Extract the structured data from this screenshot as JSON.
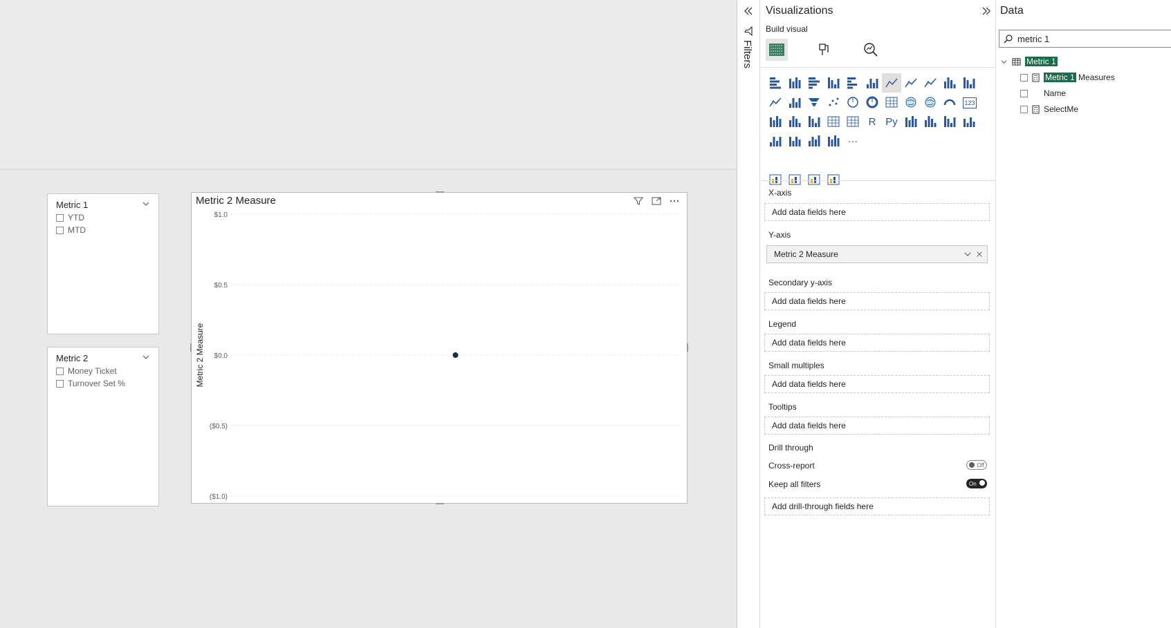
{
  "slicers": [
    {
      "title": "Metric 1",
      "items": [
        "YTD",
        "MTD"
      ]
    },
    {
      "title": "Metric 2",
      "items": [
        "Money Ticket",
        "Turnover Set %"
      ]
    }
  ],
  "chart": {
    "title": "Metric 2 Measure"
  },
  "chart_data": {
    "type": "scatter",
    "title": "Metric 2 Measure",
    "xlabel": "",
    "ylabel": "Metric 2 Measure",
    "ylim": [
      -1.0,
      1.0
    ],
    "yticks": [
      "$1.0",
      "$0.5",
      "$0.0",
      "($0.5)",
      "($1.0)"
    ],
    "ytick_values": [
      1.0,
      0.5,
      0.0,
      -0.5,
      -1.0
    ],
    "points": [
      {
        "x": 0,
        "y": 0.0
      }
    ],
    "grid": true,
    "point_color": "#1b2b4b"
  },
  "filters_pane": {
    "label": "Filters"
  },
  "viz_pane": {
    "title": "Visualizations",
    "subtitle": "Build visual",
    "wells": {
      "xaxis": {
        "label": "X-axis",
        "placeholder": "Add data fields here"
      },
      "yaxis": {
        "label": "Y-axis",
        "field": "Metric 2 Measure"
      },
      "secondary": {
        "label": "Secondary y-axis",
        "placeholder": "Add data fields here"
      },
      "legend": {
        "label": "Legend",
        "placeholder": "Add data fields here"
      },
      "small_multiples": {
        "label": "Small multiples",
        "placeholder": "Add data fields here"
      },
      "tooltips": {
        "label": "Tooltips",
        "placeholder": "Add data fields here"
      }
    },
    "drill": {
      "label": "Drill through",
      "cross_report": {
        "label": "Cross-report",
        "state": "Off"
      },
      "keep_filters": {
        "label": "Keep all filters",
        "state": "On"
      },
      "placeholder": "Add drill-through fields here"
    }
  },
  "data_pane": {
    "title": "Data",
    "search_value": "metric 1",
    "table": {
      "name_hl": "Metric 1"
    },
    "fields": [
      {
        "hl": "Metric 1",
        "rest": " Measures",
        "icon": "calculator-icon"
      },
      {
        "hl": "",
        "rest": "Name",
        "icon": ""
      },
      {
        "hl": "",
        "rest": "SelectMe",
        "icon": "calculator-icon"
      }
    ]
  },
  "colors": {
    "accent": "#1c6b4a",
    "point": "#1b2b4b"
  }
}
